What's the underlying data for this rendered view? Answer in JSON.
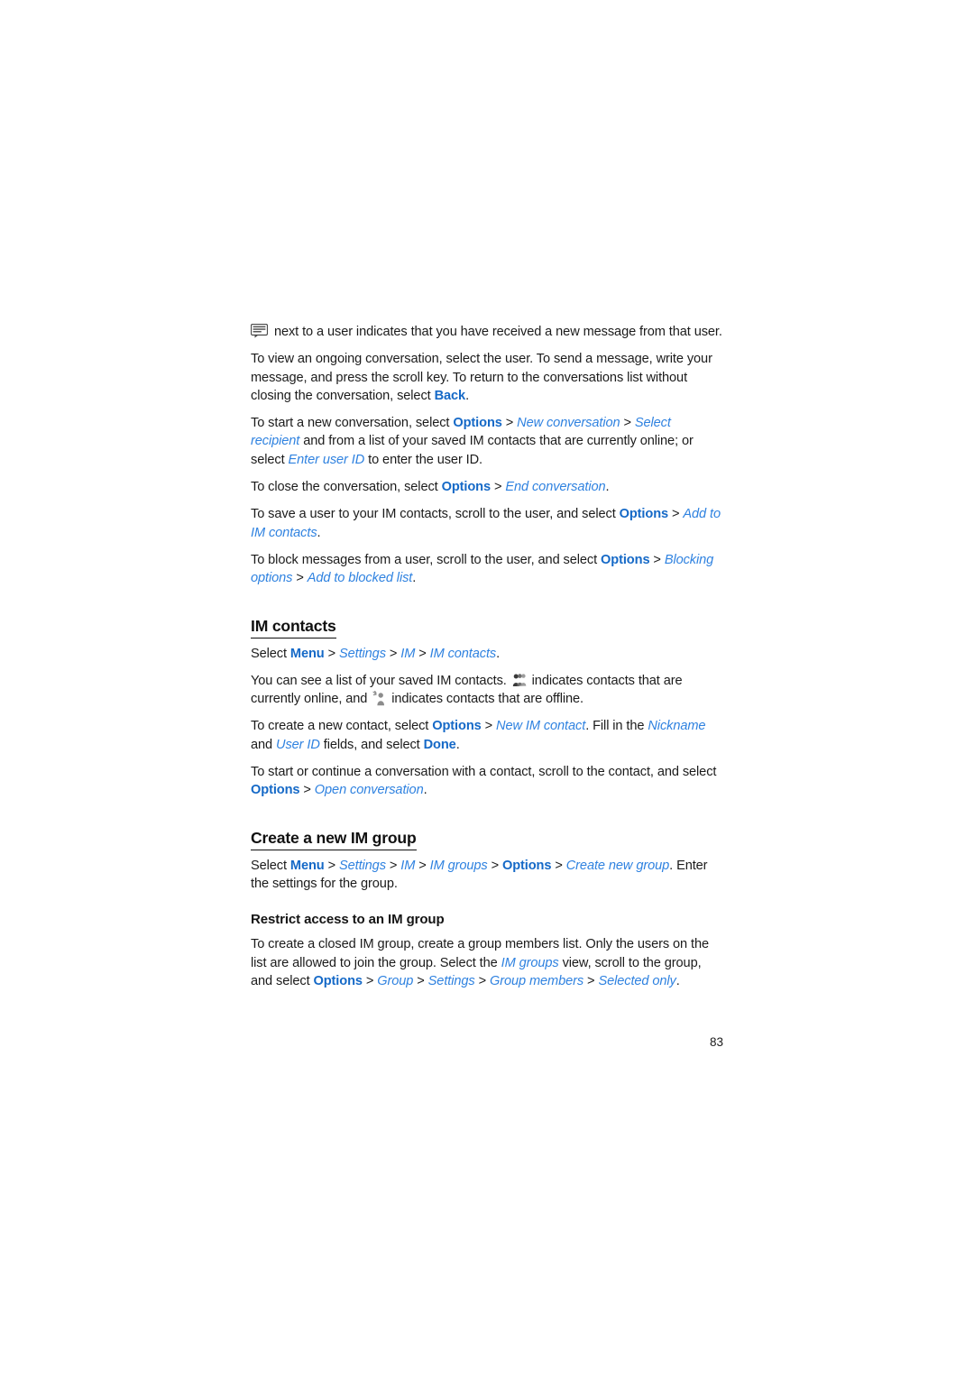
{
  "document": {
    "page_number": "83",
    "colors": {
      "command_blue": "#1569c7",
      "menuitem_blue": "#2f82e0",
      "body_text": "#1b1b1b",
      "background": "#ffffff"
    }
  },
  "icons": {
    "message": "message-bubble-icon",
    "online": "contacts-online-icon",
    "offline": "contact-offline-icon"
  },
  "body": {
    "p1": {
      "t1": " next to a user indicates that you have received a new message from that user."
    },
    "p2": {
      "t1": "To view an ongoing conversation, select the user. To send a message, write your message, and press the scroll key. To return to the conversations list without closing the conversation, select ",
      "back": "Back",
      "t2": "."
    },
    "p3": {
      "t1": "To start a new conversation, select ",
      "options": "Options",
      "s1": " > ",
      "new_conversation": "New conversation",
      "s2": " > ",
      "select_recipient": "Select recipient",
      "t2": " and from a list of your saved IM contacts that are currently online; or select ",
      "enter_user_id": "Enter user ID",
      "t3": " to enter the user ID."
    },
    "p4": {
      "t1": "To close the conversation, select ",
      "options": "Options",
      "s1": " > ",
      "end_conversation": "End conversation",
      "t2": "."
    },
    "p5": {
      "t1": "To save a user to your IM contacts, scroll to the user, and select ",
      "options": "Options",
      "s1": " > ",
      "add_to_im_contacts": "Add to IM contacts",
      "t2": "."
    },
    "p6": {
      "t1": "To block messages from a user, scroll to the user, and select ",
      "options": "Options",
      "s1": " > ",
      "blocking_options": "Blocking options",
      "s2": " > ",
      "add_to_blocked_list": "Add to blocked list",
      "t2": "."
    }
  },
  "section_im_contacts": {
    "heading": "IM contacts",
    "path": {
      "select": "Select ",
      "menu": "Menu",
      "s1": " > ",
      "settings": "Settings",
      "s2": " > ",
      "im": "IM",
      "s3": " > ",
      "im_contacts": "IM contacts",
      "end": "."
    },
    "p1": {
      "t1": "You can see a list of your saved IM contacts. ",
      "t2": " indicates contacts that are currently online, and ",
      "t3": " indicates contacts that are offline."
    },
    "p2": {
      "t1": "To create a new contact, select ",
      "options": "Options",
      "s1": " > ",
      "new_im_contact": "New IM contact",
      "t2": ". Fill in the ",
      "nickname": "Nickname",
      "t3": " and ",
      "user_id": "User ID",
      "t4": " fields, and select ",
      "done": "Done",
      "t5": "."
    },
    "p3": {
      "t1": "To start or continue a conversation with a contact, scroll to the contact, and select ",
      "options": "Options",
      "s1": " > ",
      "open_conversation": "Open conversation",
      "t2": "."
    }
  },
  "section_create_group": {
    "heading": "Create a new IM group",
    "path": {
      "select": "Select ",
      "menu": "Menu",
      "s1": " > ",
      "settings": "Settings",
      "s2": " > ",
      "im": "IM",
      "s3": " > ",
      "im_groups": "IM groups",
      "s4": " > ",
      "options": "Options",
      "s5": " > ",
      "create_new_group": "Create new group",
      "end": ". Enter the settings for the group."
    },
    "subheading": "Restrict access to an IM group",
    "p1": {
      "t1": "To create a closed IM group, create a group members list. Only the users on the list are allowed to join the group. Select the ",
      "im_groups": "IM groups",
      "t2": " view, scroll to the group, and select ",
      "options": "Options",
      "s1": " > ",
      "group": "Group",
      "s2": " > ",
      "settings": "Settings",
      "s3": " > ",
      "group_members": "Group members",
      "s4": " > ",
      "selected_only": "Selected only",
      "t3": "."
    }
  }
}
